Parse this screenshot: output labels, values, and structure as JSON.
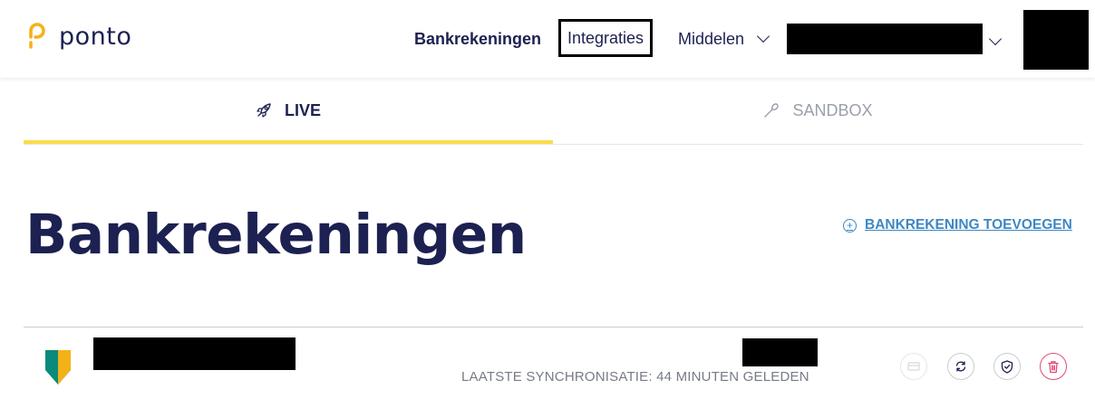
{
  "header": {
    "brand": "ponto",
    "nav": {
      "accounts": "Bankrekeningen",
      "integrations": "Integraties",
      "resources": "Middelen"
    }
  },
  "tabs": [
    {
      "label": "LIVE",
      "icon": "rocket-icon",
      "active": true
    },
    {
      "label": "SANDBOX",
      "icon": "shovel-icon",
      "active": false
    }
  ],
  "main": {
    "title": "Bankrekeningen",
    "add_account_label": "BANKREKENING TOEVOEGEN",
    "account": {
      "sync_status": "LAATSTE SYNCHRONISATIE: 44 MINUTEN GELEDEN",
      "actions": [
        "payment-icon",
        "sync-icon",
        "shield-icon",
        "trash-icon"
      ]
    }
  },
  "colors": {
    "brand_navy": "#1c2151",
    "accent_yellow": "#f9dd4b",
    "link_blue": "#3e87c4",
    "delete_red": "#e24a76"
  }
}
